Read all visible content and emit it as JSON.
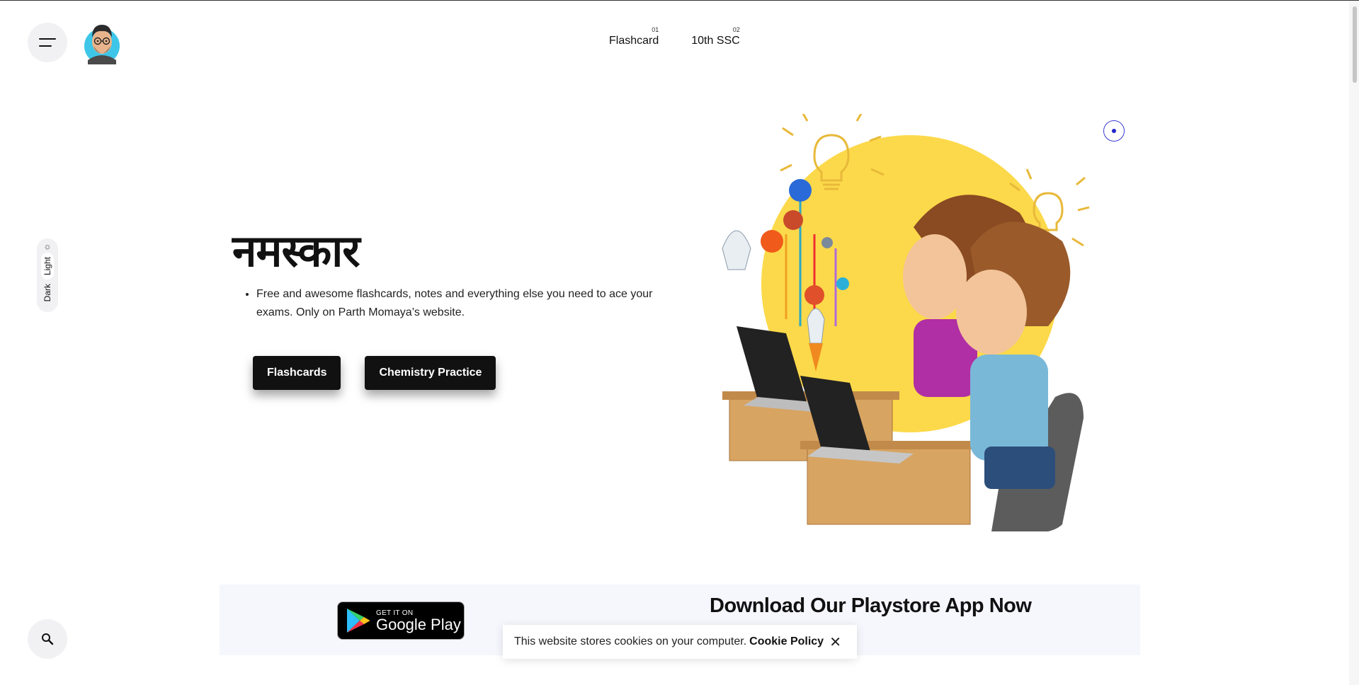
{
  "header": {
    "menu_icon": "hamburger-icon",
    "nav": [
      {
        "num": "01",
        "label": "Flashcard"
      },
      {
        "num": "02",
        "label": "10th SSC"
      }
    ]
  },
  "theme": {
    "light": "Light",
    "dark": "Dark",
    "icon": "sun-icon"
  },
  "hero": {
    "title": "नमस्कार",
    "description": "Free and awesome flashcards, notes and everything else you need to ace your exams. Only on Parth Momaya’s website.",
    "buttons": [
      "Flashcards",
      "Chemistry Practice"
    ]
  },
  "banner": {
    "play_small": "GET IT ON",
    "play_big": "Google Play",
    "title": "Download Our Playstore App Now"
  },
  "cookie": {
    "text": "This website stores cookies on your computer.",
    "link": "Cookie Policy",
    "close": "✕"
  },
  "colors": {
    "accent_yellow": "#fcd94a",
    "button_dark": "#111111",
    "banner_bg": "#f6f6fd"
  }
}
